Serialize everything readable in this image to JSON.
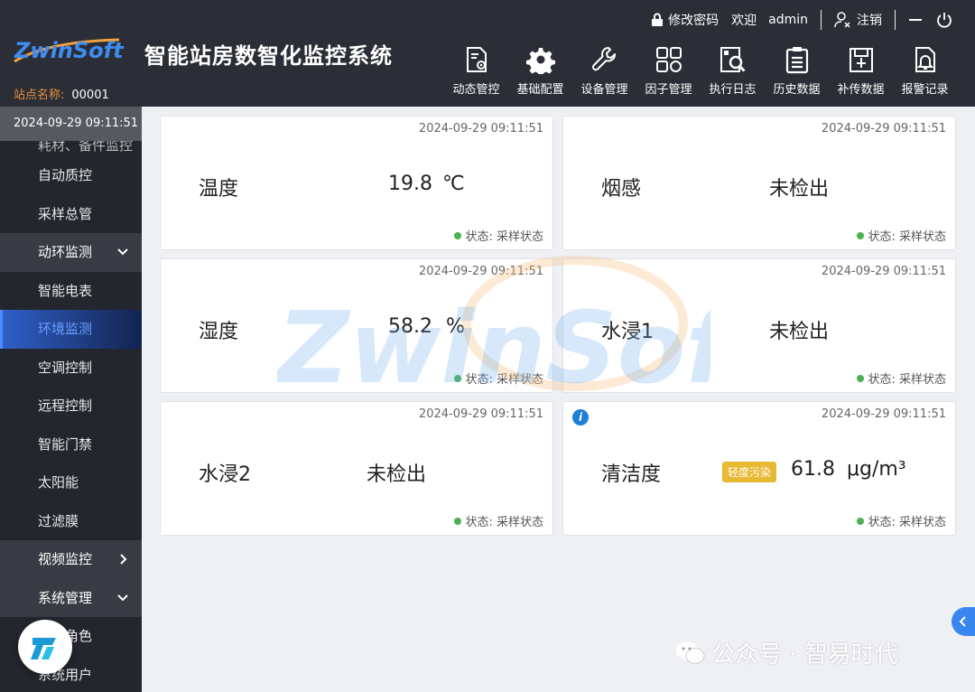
{
  "header": {
    "logo_text": "ZwinSoft",
    "title": "智能站房数智化监控系统",
    "site_label": "站点名称:",
    "site_value": "00001",
    "change_password": "修改密码",
    "welcome": "欢迎",
    "user": "admin",
    "logout": "注销"
  },
  "nav": [
    {
      "label": "动态管控",
      "icon": "dynamic-control-icon"
    },
    {
      "label": "基础配置",
      "icon": "gear-icon"
    },
    {
      "label": "设备管理",
      "icon": "wrench-icon"
    },
    {
      "label": "因子管理",
      "icon": "factor-grid-icon"
    },
    {
      "label": "执行日志",
      "icon": "log-search-icon"
    },
    {
      "label": "历史数据",
      "icon": "clipboard-icon"
    },
    {
      "label": "补传数据",
      "icon": "upload-data-icon"
    },
    {
      "label": "报警记录",
      "icon": "alarm-bell-icon"
    }
  ],
  "sidebar": {
    "datetime": "2024-09-29 09:11:51",
    "items": [
      {
        "label": "耗材、备件监控"
      },
      {
        "label": "自动质控"
      },
      {
        "label": "采样总管"
      },
      {
        "label": "动环监测"
      },
      {
        "label": "智能电表"
      },
      {
        "label": "环境监测"
      },
      {
        "label": "空调控制"
      },
      {
        "label": "远程控制"
      },
      {
        "label": "智能门禁"
      },
      {
        "label": "太阳能"
      },
      {
        "label": "过滤膜"
      },
      {
        "label": "视频监控"
      },
      {
        "label": "系统管理"
      },
      {
        "label": "系统角色"
      },
      {
        "label": "系统用户"
      }
    ]
  },
  "cards": [
    {
      "timestamp": "2024-09-29 09:11:51",
      "name": "温度",
      "value": "19.8",
      "unit": "℃",
      "status": "状态: 采样状态"
    },
    {
      "timestamp": "2024-09-29 09:11:51",
      "name": "烟感",
      "value": "未检出",
      "unit": "",
      "status": "状态: 采样状态"
    },
    {
      "timestamp": "2024-09-29 09:11:51",
      "name": "湿度",
      "value": "58.2",
      "unit": "%",
      "status": "状态: 采样状态"
    },
    {
      "timestamp": "2024-09-29 09:11:51",
      "name": "水浸1",
      "value": "未检出",
      "unit": "",
      "status": "状态: 采样状态"
    },
    {
      "timestamp": "2024-09-29 09:11:51",
      "name": "水浸2",
      "value": "未检出",
      "unit": "",
      "status": "状态: 采样状态"
    },
    {
      "timestamp": "2024-09-29 09:11:51",
      "name": "清洁度",
      "value": "61.8",
      "unit": "μg/m³",
      "status": "状态: 采样状态",
      "badge": "轻度污染"
    }
  ],
  "watermark_text": "ZwinSoft",
  "wechat_caption": "公众号 · 智易时代",
  "colors": {
    "header_bg": "#2b2e36",
    "sidebar_bg": "#23262d",
    "accent": "#3a86f0",
    "site_label": "#e8903a",
    "status_dot": "#4caf50",
    "badge": "#e8b932"
  }
}
